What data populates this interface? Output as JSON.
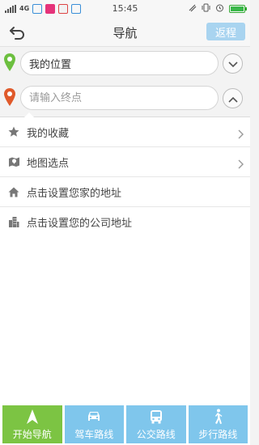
{
  "status_bar": {
    "network": "4G",
    "time": "15:45"
  },
  "header": {
    "title": "导航",
    "return_label": "返程",
    "back_icon": "back-arrow-icon"
  },
  "route": {
    "start": {
      "value": "我的位置",
      "pin_color": "#6cbf3f"
    },
    "end": {
      "value": "",
      "placeholder": "请输入终点",
      "pin_color": "#e05a2b"
    }
  },
  "list": {
    "items": [
      {
        "label": "我的收藏",
        "icon": "star-icon",
        "has_arrow": true
      },
      {
        "label": "地图选点",
        "icon": "map-pin-icon",
        "has_arrow": true
      },
      {
        "label": "点击设置您家的地址",
        "icon": "home-icon",
        "has_arrow": false
      },
      {
        "label": "点击设置您的公司地址",
        "icon": "building-icon",
        "has_arrow": false
      }
    ]
  },
  "bottom": {
    "start_nav": "开始导航",
    "drive": "驾车路线",
    "bus": "公交路线",
    "walk": "步行路线"
  },
  "colors": {
    "accent_green": "#7cc443",
    "accent_blue": "#7fc6ec",
    "return_button": "#a9d4f0"
  }
}
